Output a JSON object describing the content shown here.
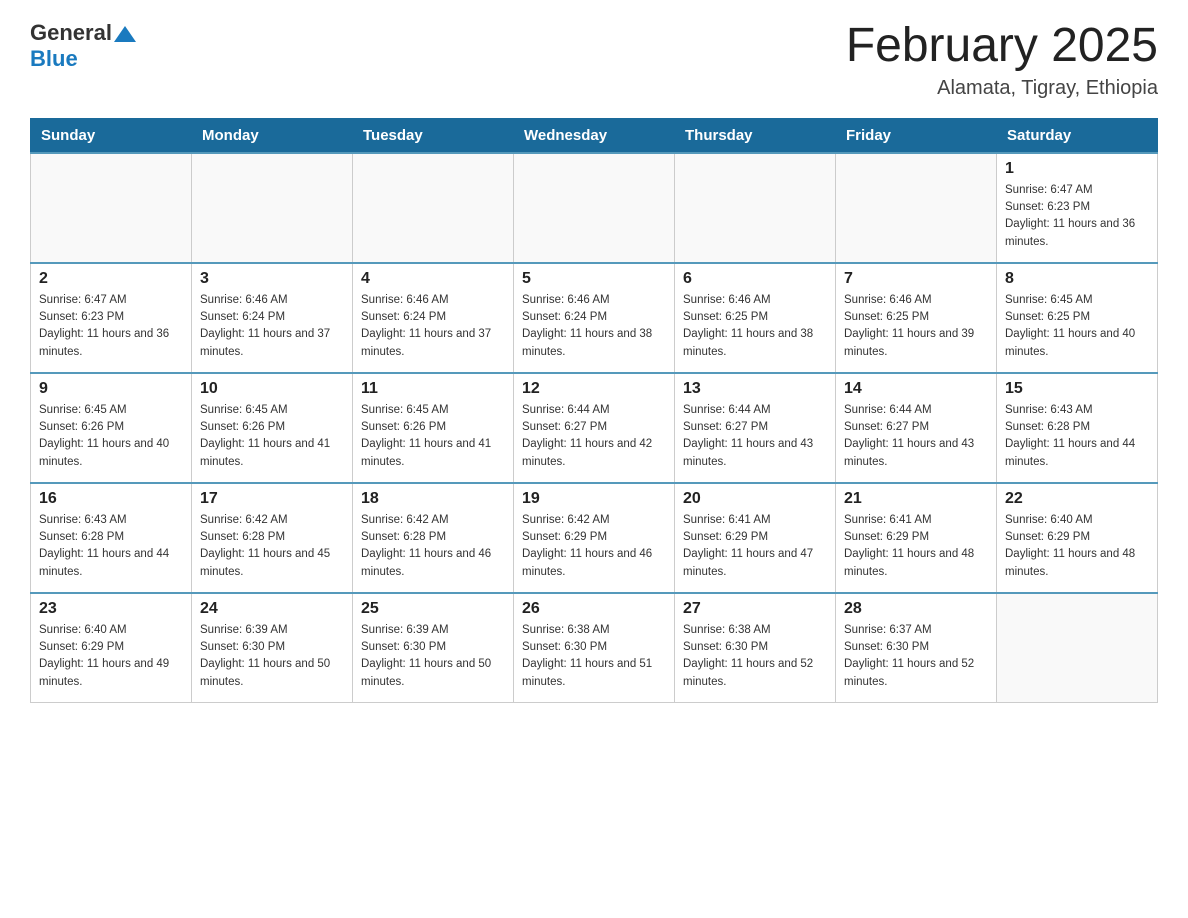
{
  "header": {
    "logo_general": "General",
    "logo_blue": "Blue",
    "month_year": "February 2025",
    "location": "Alamata, Tigray, Ethiopia"
  },
  "weekdays": [
    "Sunday",
    "Monday",
    "Tuesday",
    "Wednesday",
    "Thursday",
    "Friday",
    "Saturday"
  ],
  "weeks": [
    [
      {
        "day": "",
        "info": ""
      },
      {
        "day": "",
        "info": ""
      },
      {
        "day": "",
        "info": ""
      },
      {
        "day": "",
        "info": ""
      },
      {
        "day": "",
        "info": ""
      },
      {
        "day": "",
        "info": ""
      },
      {
        "day": "1",
        "info": "Sunrise: 6:47 AM\nSunset: 6:23 PM\nDaylight: 11 hours and 36 minutes."
      }
    ],
    [
      {
        "day": "2",
        "info": "Sunrise: 6:47 AM\nSunset: 6:23 PM\nDaylight: 11 hours and 36 minutes."
      },
      {
        "day": "3",
        "info": "Sunrise: 6:46 AM\nSunset: 6:24 PM\nDaylight: 11 hours and 37 minutes."
      },
      {
        "day": "4",
        "info": "Sunrise: 6:46 AM\nSunset: 6:24 PM\nDaylight: 11 hours and 37 minutes."
      },
      {
        "day": "5",
        "info": "Sunrise: 6:46 AM\nSunset: 6:24 PM\nDaylight: 11 hours and 38 minutes."
      },
      {
        "day": "6",
        "info": "Sunrise: 6:46 AM\nSunset: 6:25 PM\nDaylight: 11 hours and 38 minutes."
      },
      {
        "day": "7",
        "info": "Sunrise: 6:46 AM\nSunset: 6:25 PM\nDaylight: 11 hours and 39 minutes."
      },
      {
        "day": "8",
        "info": "Sunrise: 6:45 AM\nSunset: 6:25 PM\nDaylight: 11 hours and 40 minutes."
      }
    ],
    [
      {
        "day": "9",
        "info": "Sunrise: 6:45 AM\nSunset: 6:26 PM\nDaylight: 11 hours and 40 minutes."
      },
      {
        "day": "10",
        "info": "Sunrise: 6:45 AM\nSunset: 6:26 PM\nDaylight: 11 hours and 41 minutes."
      },
      {
        "day": "11",
        "info": "Sunrise: 6:45 AM\nSunset: 6:26 PM\nDaylight: 11 hours and 41 minutes."
      },
      {
        "day": "12",
        "info": "Sunrise: 6:44 AM\nSunset: 6:27 PM\nDaylight: 11 hours and 42 minutes."
      },
      {
        "day": "13",
        "info": "Sunrise: 6:44 AM\nSunset: 6:27 PM\nDaylight: 11 hours and 43 minutes."
      },
      {
        "day": "14",
        "info": "Sunrise: 6:44 AM\nSunset: 6:27 PM\nDaylight: 11 hours and 43 minutes."
      },
      {
        "day": "15",
        "info": "Sunrise: 6:43 AM\nSunset: 6:28 PM\nDaylight: 11 hours and 44 minutes."
      }
    ],
    [
      {
        "day": "16",
        "info": "Sunrise: 6:43 AM\nSunset: 6:28 PM\nDaylight: 11 hours and 44 minutes."
      },
      {
        "day": "17",
        "info": "Sunrise: 6:42 AM\nSunset: 6:28 PM\nDaylight: 11 hours and 45 minutes."
      },
      {
        "day": "18",
        "info": "Sunrise: 6:42 AM\nSunset: 6:28 PM\nDaylight: 11 hours and 46 minutes."
      },
      {
        "day": "19",
        "info": "Sunrise: 6:42 AM\nSunset: 6:29 PM\nDaylight: 11 hours and 46 minutes."
      },
      {
        "day": "20",
        "info": "Sunrise: 6:41 AM\nSunset: 6:29 PM\nDaylight: 11 hours and 47 minutes."
      },
      {
        "day": "21",
        "info": "Sunrise: 6:41 AM\nSunset: 6:29 PM\nDaylight: 11 hours and 48 minutes."
      },
      {
        "day": "22",
        "info": "Sunrise: 6:40 AM\nSunset: 6:29 PM\nDaylight: 11 hours and 48 minutes."
      }
    ],
    [
      {
        "day": "23",
        "info": "Sunrise: 6:40 AM\nSunset: 6:29 PM\nDaylight: 11 hours and 49 minutes."
      },
      {
        "day": "24",
        "info": "Sunrise: 6:39 AM\nSunset: 6:30 PM\nDaylight: 11 hours and 50 minutes."
      },
      {
        "day": "25",
        "info": "Sunrise: 6:39 AM\nSunset: 6:30 PM\nDaylight: 11 hours and 50 minutes."
      },
      {
        "day": "26",
        "info": "Sunrise: 6:38 AM\nSunset: 6:30 PM\nDaylight: 11 hours and 51 minutes."
      },
      {
        "day": "27",
        "info": "Sunrise: 6:38 AM\nSunset: 6:30 PM\nDaylight: 11 hours and 52 minutes."
      },
      {
        "day": "28",
        "info": "Sunrise: 6:37 AM\nSunset: 6:30 PM\nDaylight: 11 hours and 52 minutes."
      },
      {
        "day": "",
        "info": ""
      }
    ]
  ]
}
